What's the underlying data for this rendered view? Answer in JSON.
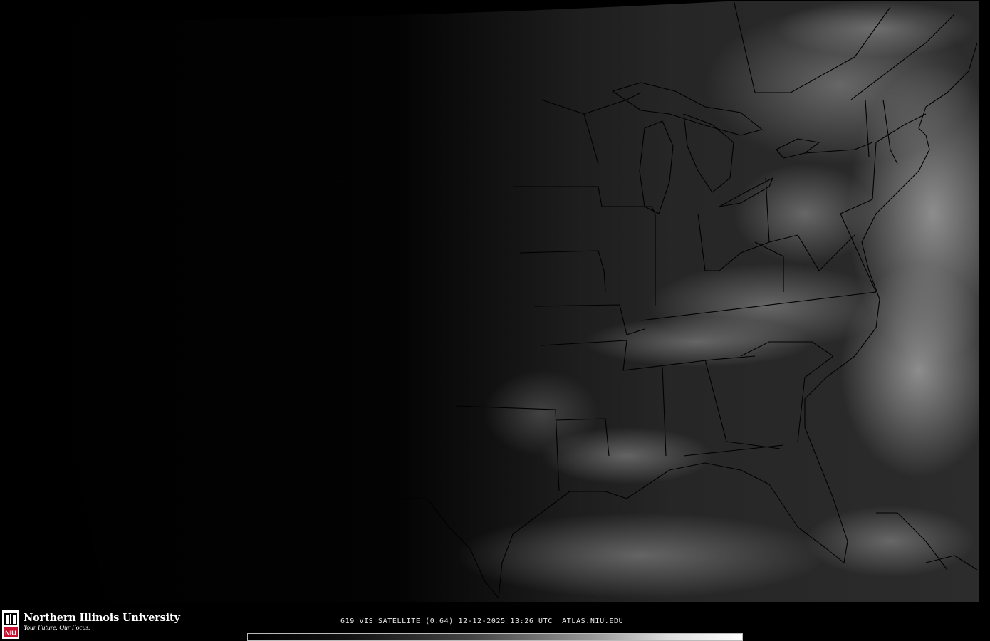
{
  "footer": {
    "org_name": "Northern Illinois University",
    "tagline": "Your Future. Our Focus.",
    "logo_letters": "NIU",
    "caption": "619 VIS SATELLITE (0.64) 12-12-2025 13:26 UTC  ATLAS.NIU.EDU"
  },
  "map": {
    "colors": {
      "night": "#000000",
      "day_land": "#2b2b2b",
      "border": "#000000",
      "cloud": "#d8d8d8",
      "logo_red": "#c8102e"
    }
  }
}
